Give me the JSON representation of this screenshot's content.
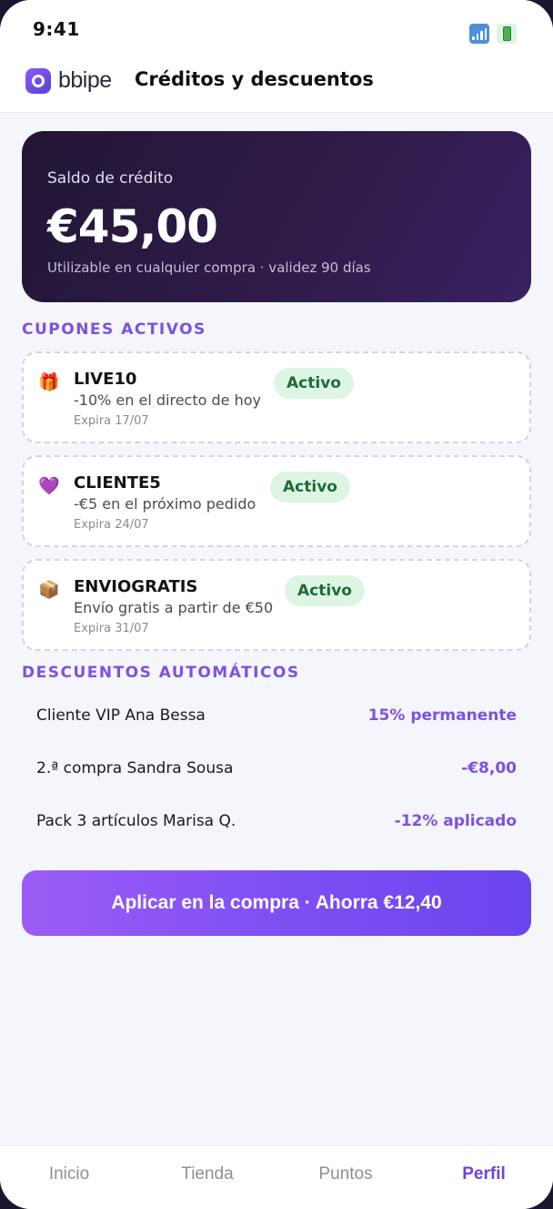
{
  "status_bar": {
    "time": "9:41",
    "signal_icon": "signal-icon",
    "battery_icon": "battery-icon"
  },
  "header": {
    "logo_text": "bbipe",
    "title": "Créditos y descuentos"
  },
  "credit": {
    "label": "Saldo de crédito",
    "amount": "€45,00",
    "note": "Utilizable en cualquier compra · validez 90 días"
  },
  "coupons": {
    "section_title": "CUPONES ACTIVOS",
    "items": [
      {
        "icon": "gift-icon",
        "emoji": "🎁",
        "code": "LIVE10",
        "description": "-10% en el directo de hoy",
        "expiry": "Expira 17/07",
        "status": "Activo"
      },
      {
        "icon": "purple-heart-icon",
        "emoji": "💜",
        "code": "CLIENTE5",
        "description": "-€5 en el próximo pedido",
        "expiry": "Expira 24/07",
        "status": "Activo"
      },
      {
        "icon": "package-icon",
        "emoji": "📦",
        "code": "ENVIOGRATIS",
        "description": "Envío gratis a partir de €50",
        "expiry": "Expira 31/07",
        "status": "Activo"
      }
    ]
  },
  "auto_discounts": {
    "section_title": "DESCUENTOS AUTOMÁTICOS",
    "items": [
      {
        "label": "Cliente VIP Ana Bessa",
        "value": "15% permanente"
      },
      {
        "label": "2.ª compra Sandra Sousa",
        "value": "-€8,00"
      },
      {
        "label": "Pack 3 artículos Marisa Q.",
        "value": "-12% aplicado"
      }
    ]
  },
  "cta": {
    "label": "Aplicar en la compra · Ahorra €12,40"
  },
  "bottom_nav": {
    "items": [
      {
        "label": "Inicio",
        "active": false
      },
      {
        "label": "Tienda",
        "active": false
      },
      {
        "label": "Puntos",
        "active": false
      },
      {
        "label": "Perfil",
        "active": true
      }
    ]
  },
  "colors": {
    "accent": "#7b52e0",
    "card_dark": "#2e1b48",
    "badge_bg": "#ddf6e4",
    "badge_text": "#1e6b37",
    "page_bg": "#f5f5fc"
  }
}
